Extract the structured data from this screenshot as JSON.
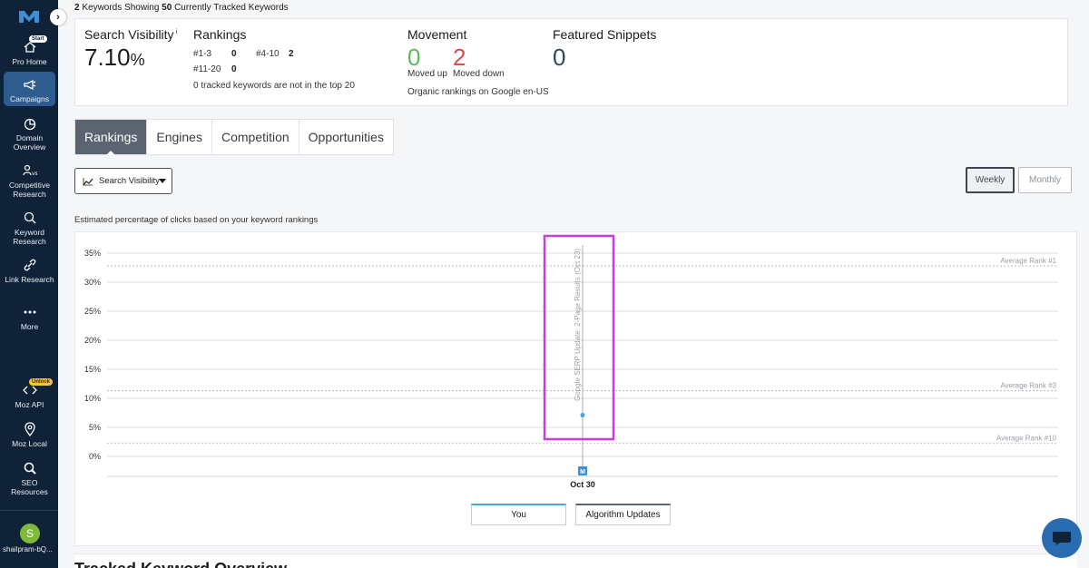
{
  "sidebar": {
    "items": [
      {
        "label": "Pro Home",
        "badge": "Start",
        "icon": "home-icon"
      },
      {
        "label": "Campaigns",
        "icon": "megaphone-icon",
        "active": true
      },
      {
        "label": "Domain Overview",
        "icon": "pie-chart-icon"
      },
      {
        "label": "Competitive Research",
        "icon": "users-vs-icon"
      },
      {
        "label": "Keyword Research",
        "icon": "search-icon"
      },
      {
        "label": "Link Research",
        "icon": "link-icon"
      },
      {
        "label": "More",
        "icon": "dots-icon"
      },
      {
        "label": "Moz API",
        "badge": "Unlock",
        "icon": "code-icon"
      },
      {
        "label": "Moz Local",
        "icon": "pin-icon"
      },
      {
        "label": "SEO Resources",
        "icon": "magnifier-icon"
      }
    ],
    "user_initial": "S",
    "user_name": "shailpram-bQ..."
  },
  "header": {
    "kw_count": "2",
    "kw_text_1": " Keywords Showing ",
    "tracked_count": "50",
    "kw_text_2": " Currently Tracked Keywords"
  },
  "summary": {
    "visibility_title": "Search Visibility",
    "visibility_info": "i",
    "visibility_value": "7.10",
    "visibility_unit": "%",
    "rankings_title": "Rankings",
    "r1_label": "#1-3",
    "r1_value": "0",
    "r2_label": "#4-10",
    "r2_value": "2",
    "r3_label": "#11-20",
    "r3_value": "0",
    "rankings_note": "0 tracked keywords are not in the top 20",
    "movement_title": "Movement",
    "moved_up_value": "0",
    "moved_up_label": "Moved up",
    "moved_down_value": "2",
    "moved_down_label": "Moved down",
    "movement_note": "Organic rankings on Google en-US",
    "snippets_title": "Featured Snippets",
    "snippets_value": "0"
  },
  "tabs": [
    "Rankings",
    "Engines",
    "Competition",
    "Opportunities"
  ],
  "controls": {
    "metric_dropdown": "Search Visibility",
    "weekly": "Weekly",
    "monthly": "Monthly"
  },
  "caption": "Estimated percentage of clicks based on your keyword rankings",
  "chart_data": {
    "type": "line",
    "y_ticks": [
      "35%",
      "30%",
      "25%",
      "20%",
      "15%",
      "10%",
      "5%",
      "0%"
    ],
    "ylim": [
      0,
      35
    ],
    "x": [
      "Oct 30"
    ],
    "series": [
      {
        "name": "You",
        "values": [
          7.1
        ]
      }
    ],
    "reference_lines": [
      {
        "label": "Average Rank #1",
        "value": 32.8
      },
      {
        "label": "Average Rank #3",
        "value": 11.3
      },
      {
        "label": "Average Rank #10",
        "value": 2.3
      }
    ],
    "annotation": "Google SERP Update: 2-Page Results (Oct 23)",
    "legend": [
      "You",
      "Algorithm Updates"
    ],
    "colors": {
      "you": "#4aa8d8",
      "algorithm": "#5b6470",
      "highlight": "#c83fe0"
    }
  },
  "bottom": {
    "title": "Tracked Keyword Overview"
  },
  "colors": {
    "sidebar": "#0f2238",
    "moved_up": "#5cb85c",
    "moved_down": "#e5484d",
    "snippets": "#2c4866"
  }
}
